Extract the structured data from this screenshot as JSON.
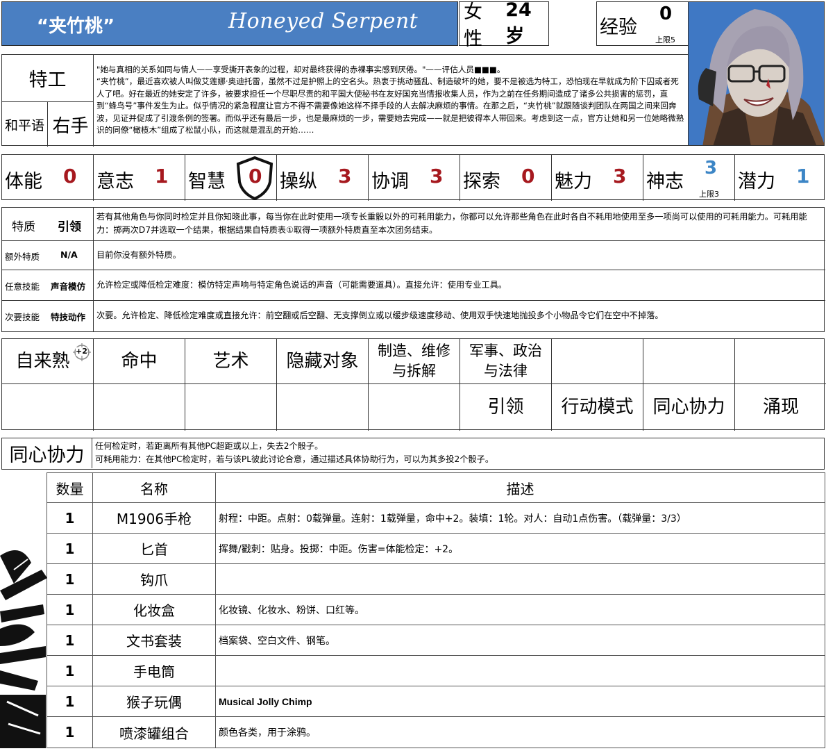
{
  "header": {
    "cn_name": "“夹竹桃”",
    "en_name": "Honeyed Serpent",
    "sex": "女性",
    "age": "24岁",
    "exp_label": "经验",
    "exp_value": "0",
    "exp_cap": "上限5"
  },
  "role": {
    "title": "特工",
    "lang_label": "和平语",
    "hand": "右手",
    "bio": "\"她与真相的关系如同与情人——享受撕开表象的过程，却对最终获得的赤裸事实感到厌倦。\"——评估人员■■■。\n“夹竹桃”，最近喜欢被人叫做艾莲娜·奥迪托雷，虽然不过是护照上的空名头。热衷于挑动骚乱、制造破坏的她，要不是被选为特工，恐怕现在早就成为阶下囚或者死人了吧。好在最近的她安定了许多，被要求担任一个尽职尽责的和平国大使秘书在友好国充当情报收集人员，作为之前在任务期间造成了诸多公共损害的惩罚，直到“蜂鸟号”事件发生为止。似乎情况的紧急程度让官方不得不需要像她这样不择手段的人去解决麻烦的事情。在那之后，“夹竹桃”就跟随谈判团队在两国之间来回奔波，见证并促成了引渡条例的签署。而似乎还有最后一步，也是最麻烦的一步，需要她去完成——就是把彼得本人带回来。考虑到这一点，官方让她和另一位她略微熟识的同僚“橄榄木”组成了松鼠小队，而这就是混乱的开始……"
  },
  "stats": [
    {
      "label": "体能",
      "value": "0",
      "color": "#a6191f"
    },
    {
      "label": "意志",
      "value": "1",
      "color": "#a6191f"
    },
    {
      "label": "智慧",
      "value": "0",
      "color": "#a6191f",
      "shield": true
    },
    {
      "label": "操纵",
      "value": "3",
      "color": "#a6191f"
    },
    {
      "label": "协调",
      "value": "3",
      "color": "#a6191f"
    },
    {
      "label": "探索",
      "value": "0",
      "color": "#a6191f"
    },
    {
      "label": "魅力",
      "value": "3",
      "color": "#a6191f"
    },
    {
      "label": "神志",
      "value": "3",
      "color": "#3d86c6",
      "cap": "上限3"
    },
    {
      "label": "潜力",
      "value": "1",
      "color": "#3d86c6"
    }
  ],
  "traits": [
    {
      "label": "特质",
      "name": "引领",
      "desc": "若有其他角色与你同时检定并且你知晓此事，每当你在此时使用一项专长重骰以外的可耗用能力，你都可以允许那些角色在此时各自不耗用地使用至多一项尚可以使用的可耗用能力。可耗用能力：掷两次D7并选取一个结果，根据结果自特质表①取得一项额外特质直至本次团务结束。"
    },
    {
      "label": "额外特质",
      "name": "N/A",
      "desc": "目前你没有额外特质。"
    },
    {
      "label": "任意技能",
      "name": "声音模仿",
      "desc": "允许检定或降低检定难度：模仿特定声响与特定角色说话的声音（可能需要道具）。直接允许：使用专业工具。"
    },
    {
      "label": "次要技能",
      "name": "特技动作",
      "desc": "次要。允许检定、降低检定难度或直接允许：前空翻或后空翻、无支撑倒立或以缓步级速度移动、使用双手快速地抛投多个小物品令它们在空中不掉落。"
    }
  ],
  "skills": {
    "row1": [
      "自来熟",
      "命中",
      "艺术",
      "隐藏对象",
      "制造、维修\n与拆解",
      "军事、政治\n与法律",
      "",
      "",
      ""
    ],
    "row1_badge": "+2",
    "row2": [
      "",
      "",
      "",
      "",
      "",
      "引领",
      "行动模式",
      "同心协力",
      "涌现"
    ]
  },
  "rule": {
    "title": "同心协力",
    "line1": "任何检定时，若距离所有其他PC超距或以上，失去2个骰子。",
    "line2": "可耗用能力：在其他PC检定时，若与该PL彼此讨论合意，通过描述具体协助行为，可以为其多投2个骰子。"
  },
  "items": {
    "headers": [
      "数量",
      "名称",
      "描述"
    ],
    "rows": [
      {
        "qty": "1",
        "name": "M1906手枪",
        "desc": "射程：中距。点射：0载弹量。连射：1载弹量，命中+2。装填：1轮。对人：自动1点伤害。（载弹量：3/3）"
      },
      {
        "qty": "1",
        "name": "匕首",
        "desc": "挥舞/戳刺：贴身。投掷：中距。伤害=体能检定：+2。"
      },
      {
        "qty": "1",
        "name": "钩爪",
        "desc": ""
      },
      {
        "qty": "1",
        "name": "化妆盒",
        "desc": "化妆镜、化妆水、粉饼、口红等。"
      },
      {
        "qty": "1",
        "name": "文书套装",
        "desc": "档案袋、空白文件、钢笔。"
      },
      {
        "qty": "1",
        "name": "手电筒",
        "desc": ""
      },
      {
        "qty": "1",
        "name": "猴子玩偶",
        "desc": "Musical Jolly Chimp"
      },
      {
        "qty": "1",
        "name": "喷漆罐组合",
        "desc": "颜色各类，用于涂鸦。"
      }
    ]
  }
}
